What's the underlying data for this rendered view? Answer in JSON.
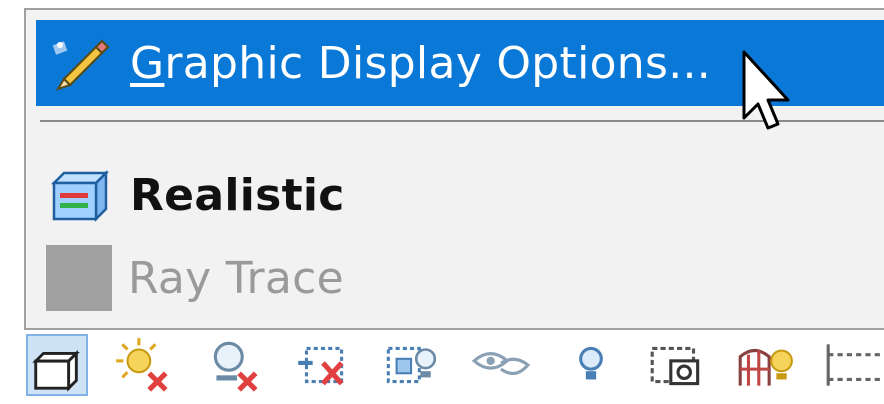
{
  "menu": {
    "items": [
      {
        "label_accel": "G",
        "label_rest": "raphic Display Options...",
        "icon": "pencil-icon",
        "state": "highlighted"
      },
      {
        "label": "Realistic",
        "icon": "realistic-cube-icon",
        "state": "enabled"
      },
      {
        "label": "Ray Trace",
        "icon": "ray-trace-swatch-icon",
        "state": "disabled"
      }
    ]
  },
  "toolbar": {
    "icons": [
      "shaded-cube-icon",
      "sun-remove-icon",
      "light-remove-icon",
      "effect-remove-icon",
      "effect-light-icon",
      "eye-icon",
      "bulb-icon",
      "camera-icon",
      "grid-light-icon",
      "ruler-icon"
    ]
  },
  "colors": {
    "highlight": "#0a78d7",
    "menu_bg": "#f2f2f2",
    "disabled_text": "#9a9a9a",
    "active_tool_bg": "#cfe3f7"
  }
}
